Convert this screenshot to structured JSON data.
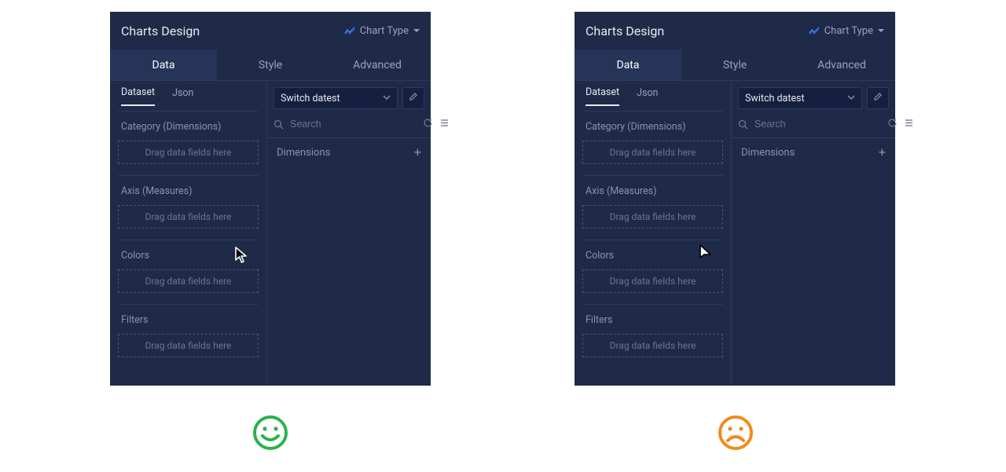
{
  "header": {
    "title": "Charts Design",
    "chartType": "Chart Type"
  },
  "tabs": {
    "data": "Data",
    "style": "Style",
    "advanced": "Advanced"
  },
  "subtabs": {
    "dataset": "Dataset",
    "json": "Json"
  },
  "sections": {
    "category": "Category (Dimensions)",
    "axis": "Axis (Measures)",
    "colors": "Colors",
    "filters": "Filters",
    "placeholder": "Drag data fields here"
  },
  "rightPane": {
    "switchLabel": "Switch datest",
    "searchPlaceholder": "Search",
    "dimensions": "Dimensions"
  },
  "colors": {
    "good": "#2bb24c",
    "bad": "#f08b1d"
  }
}
